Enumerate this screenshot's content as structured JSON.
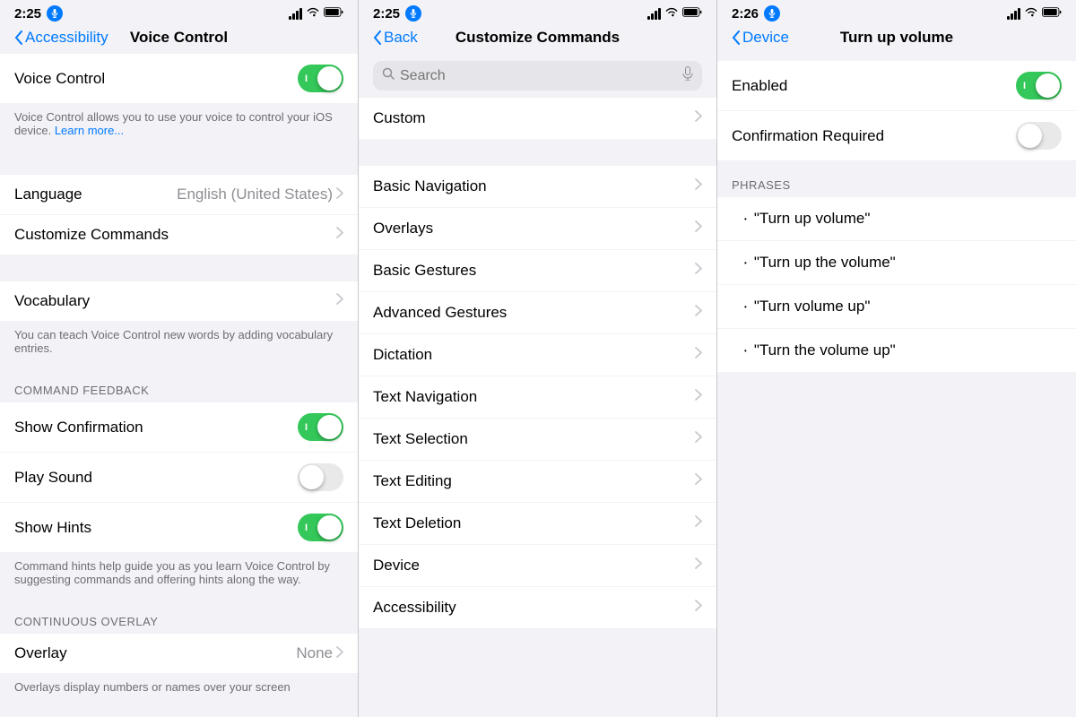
{
  "panel1": {
    "statusBar": {
      "time": "2:25",
      "hasMic": true
    },
    "nav": {
      "backLabel": "Accessibility",
      "title": "Voice Control"
    },
    "voiceControlToggle": true,
    "voiceControlDesc": "Voice Control allows you to use your voice to control your iOS device.",
    "voiceControlLink": "Learn more...",
    "languageLabel": "Language",
    "languageValue": "English (United States)",
    "customizeLabel": "Customize Commands",
    "vocabularyLabel": "Vocabulary",
    "vocabularyDesc": "You can teach Voice Control new words by adding vocabulary entries.",
    "commandFeedbackHeader": "COMMAND FEEDBACK",
    "showConfirmationLabel": "Show Confirmation",
    "showConfirmationOn": true,
    "playSoundLabel": "Play Sound",
    "playSoundOn": false,
    "showHintsLabel": "Show Hints",
    "showHintsOn": true,
    "hintsDesc": "Command hints help guide you as you learn Voice Control by suggesting commands and offering hints along the way.",
    "continuousOverlayHeader": "CONTINUOUS OVERLAY",
    "overlayLabel": "Overlay",
    "overlayValue": "None",
    "overlayDesc": "Overlays display numbers or names over your screen"
  },
  "panel2": {
    "statusBar": {
      "time": "2:25",
      "hasMic": true
    },
    "nav": {
      "backLabel": "Back",
      "title": "Customize Commands"
    },
    "search": {
      "placeholder": "Search"
    },
    "customLabel": "Custom",
    "categories": [
      "Basic Navigation",
      "Overlays",
      "Basic Gestures",
      "Advanced Gestures",
      "Dictation",
      "Text Navigation",
      "Text Selection",
      "Text Editing",
      "Text Deletion",
      "Device",
      "Accessibility"
    ]
  },
  "panel3": {
    "statusBar": {
      "time": "2:26",
      "hasMic": true
    },
    "nav": {
      "backLabel": "Device",
      "title": "Turn up volume"
    },
    "enabledLabel": "Enabled",
    "enabledOn": true,
    "confirmationLabel": "Confirmation Required",
    "confirmationOn": false,
    "phrasesHeader": "PHRASES",
    "phrases": [
      "\"Turn up volume\"",
      "\"Turn up the volume\"",
      "\"Turn volume up\"",
      "\"Turn the volume up\""
    ]
  },
  "icons": {
    "chevronRight": "›",
    "chevronLeft": "‹"
  }
}
